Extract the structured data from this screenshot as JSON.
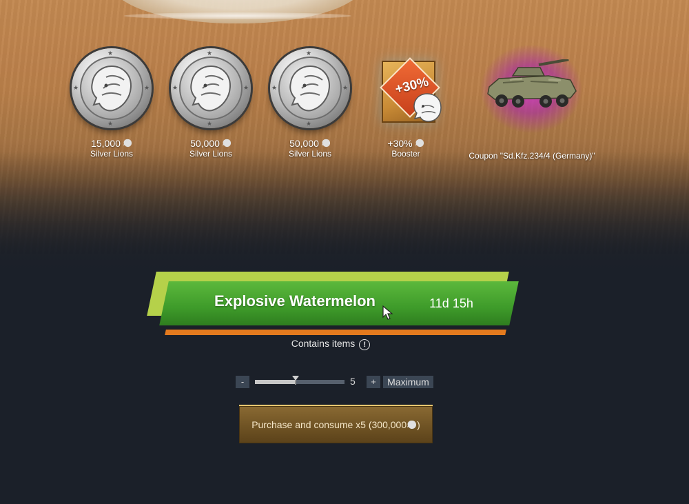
{
  "rewards": [
    {
      "amount": "15,000",
      "name": "Silver Lions"
    },
    {
      "amount": "50,000",
      "name": "Silver Lions"
    },
    {
      "amount": "50,000",
      "name": "Silver Lions"
    },
    {
      "amount": "+30%",
      "name": "Booster"
    },
    {
      "amount": "",
      "name": "Coupon \"Sd.Kfz.234/4 (Germany)\""
    }
  ],
  "booster_badge": "+30%",
  "trophy": {
    "title": "Explosive Watermelon",
    "timer": "11d 15h"
  },
  "contains_label": "Contains items",
  "quantity": {
    "minus": "-",
    "plus": "+",
    "value": "5",
    "max_label": "Maximum",
    "slider_fraction": 0.45
  },
  "purchase_label": "Purchase and consume x5 (300,000",
  "purchase_suffix": ")",
  "icons": [
    "silver-lion-coin-icon",
    "booster-card-icon",
    "vehicle-icon",
    "info-icon",
    "silver-lion-mini-icon",
    "mouse-cursor-icon"
  ],
  "colors": {
    "banner_green": "#3e9b2a",
    "banner_lime": "#b5d14a",
    "banner_stripe": "#e47a1e",
    "purchase_gold": "#8a6a33",
    "vehicle_glow": "#d23cc8"
  }
}
